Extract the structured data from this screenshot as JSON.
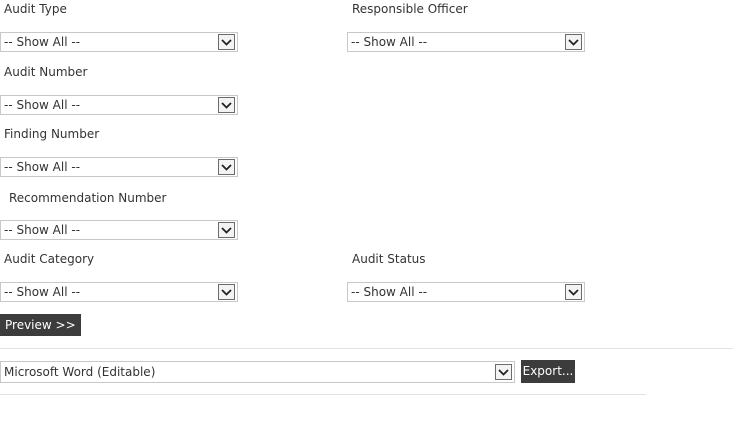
{
  "filters": {
    "audit_type": {
      "label": "Audit Type",
      "value": "-- Show All --"
    },
    "responsible_officer": {
      "label": "Responsible Officer",
      "value": "-- Show All --"
    },
    "audit_number": {
      "label": "Audit Number",
      "value": "-- Show All --"
    },
    "finding_number": {
      "label": "Finding Number",
      "value": "-- Show All --"
    },
    "recommendation_number": {
      "label": "Recommendation Number",
      "value": "-- Show All --"
    },
    "audit_category": {
      "label": "Audit Category",
      "value": "-- Show All --"
    },
    "audit_status": {
      "label": "Audit Status",
      "value": "-- Show All --"
    }
  },
  "preview_button": "Preview >>",
  "export": {
    "format": "Microsoft Word (Editable)",
    "button": "Export..."
  },
  "icons": {
    "dropdown": "chevron-down-icon"
  }
}
